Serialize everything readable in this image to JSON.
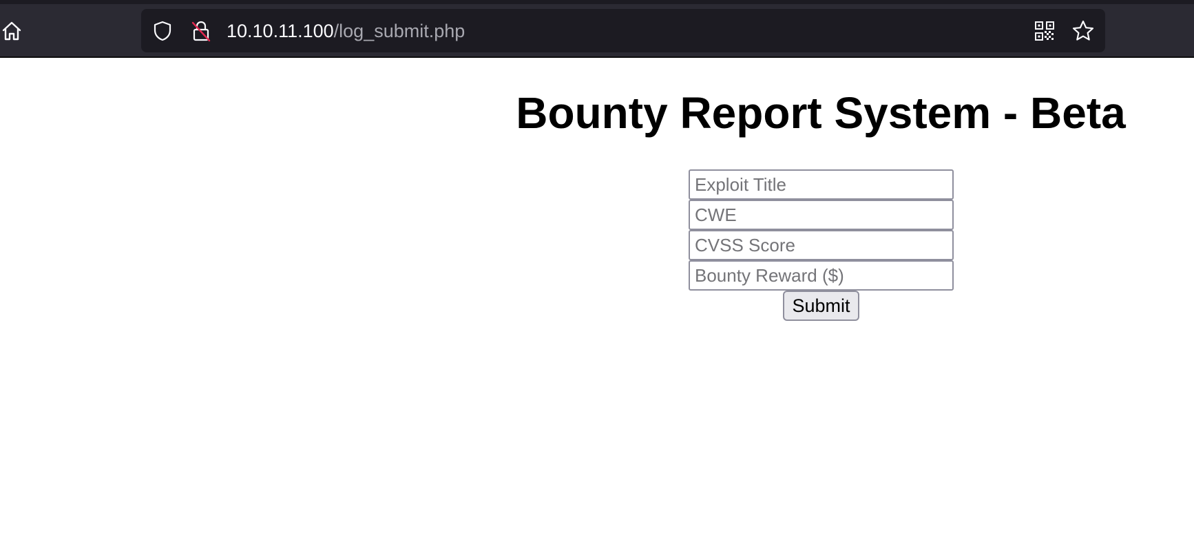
{
  "browser": {
    "url_host": "10.10.11.100",
    "url_path": "/log_submit.php",
    "icons": {
      "home": "home-icon",
      "tracking_protection": "shield-icon",
      "connection": "insecure-lock-icon",
      "qr_code": "qr-code-icon",
      "bookmark": "star-icon"
    },
    "colors": {
      "toolbar": "#2b2a33",
      "url_field": "#1c1b22",
      "insecure_slash": "#e22850"
    }
  },
  "page": {
    "title": "Bounty Report System - Beta",
    "form": {
      "fields": [
        {
          "placeholder": "Exploit Title",
          "value": ""
        },
        {
          "placeholder": "CWE",
          "value": ""
        },
        {
          "placeholder": "CVSS Score",
          "value": ""
        },
        {
          "placeholder": "Bounty Reward ($)",
          "value": ""
        }
      ],
      "submit_label": "Submit"
    }
  }
}
